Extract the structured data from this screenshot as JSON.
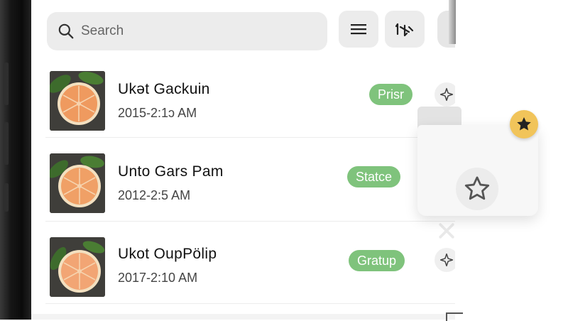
{
  "search": {
    "placeholder": "Search"
  },
  "toolbar": {
    "buttons": [
      {
        "icon": "list-icon"
      },
      {
        "icon": "sort-arrows-icon"
      }
    ]
  },
  "rows": [
    {
      "title": "Ukət Gackuin",
      "time": "2015-2:1ɔ AM",
      "status": "Prisr",
      "pin_icon": "pin-icon"
    },
    {
      "title": "Unto Gars Pam",
      "time": "2012-2:5 AM",
      "status": "Statce",
      "pin_icon": "none"
    },
    {
      "title": "Ukot OupPölip",
      "time": "2017-2:10 AM",
      "status": "Gratup",
      "pin_icon": "pin-icon"
    }
  ],
  "popover": {
    "icon": "star-outline-icon",
    "badge_icon": "star-filled-icon"
  },
  "colors": {
    "status_green": "#7fc37c",
    "badge_yellow": "#f1c45a",
    "search_bg": "#ececec"
  }
}
